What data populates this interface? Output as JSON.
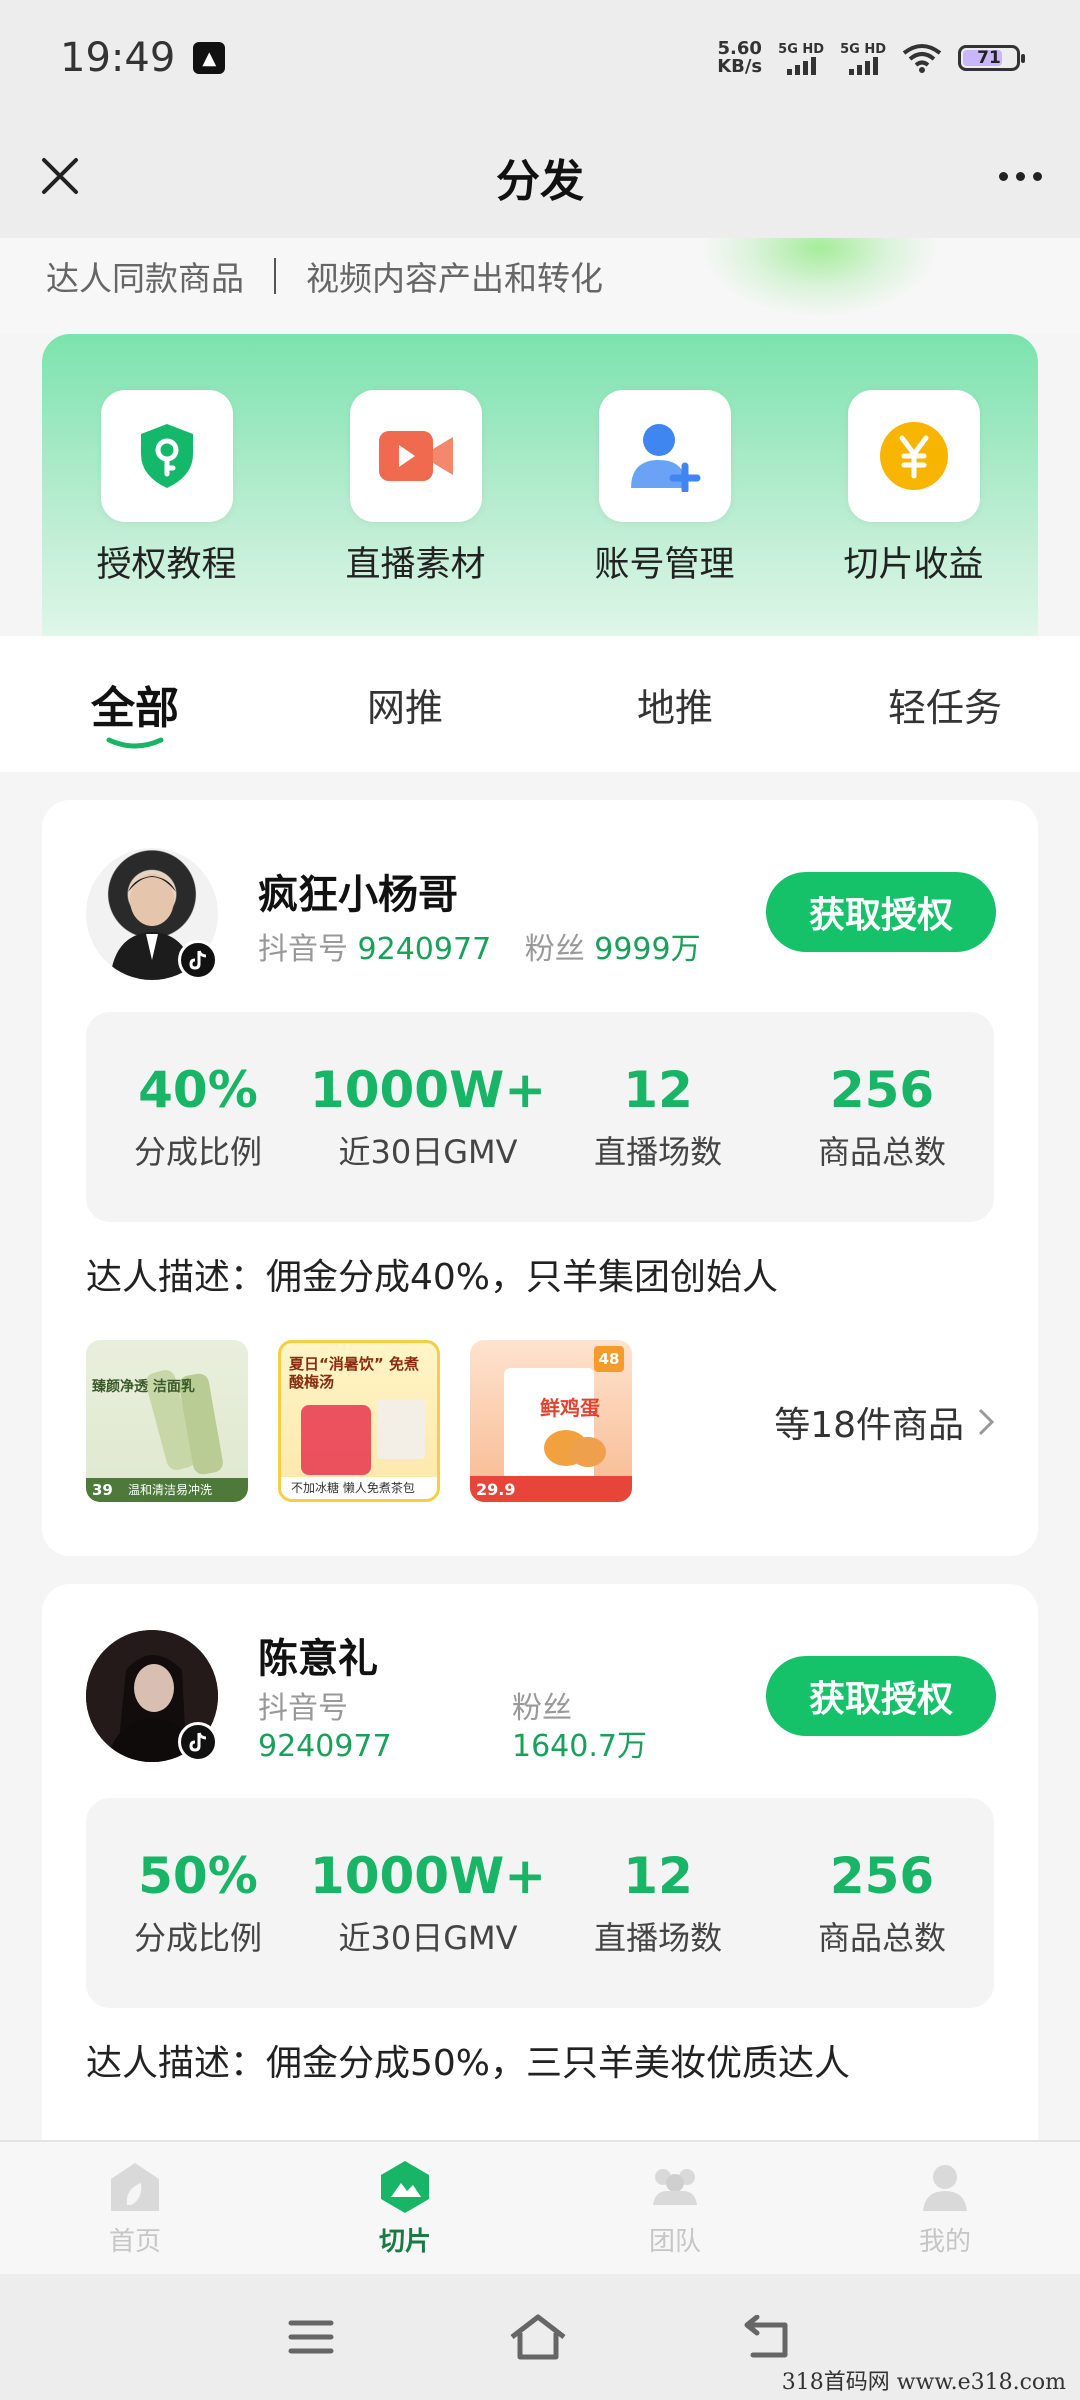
{
  "status_bar": {
    "time": "19:49",
    "net_speed_value": "5.60",
    "net_speed_unit": "KB/s",
    "sim1_label": "5G HD",
    "sim2_label": "5G HD",
    "battery_level": "71"
  },
  "header": {
    "title": "分发"
  },
  "banner": {
    "left_text": "达人同款商品",
    "right_text": "视频内容产出和转化"
  },
  "quick_access": [
    {
      "label": "授权教程",
      "icon": "shield-key-icon",
      "color": "#14b86a"
    },
    {
      "label": "直播素材",
      "icon": "video-camera-icon",
      "color": "#f06a4f"
    },
    {
      "label": "账号管理",
      "icon": "user-add-icon",
      "color": "#3f86f0"
    },
    {
      "label": "切片收益",
      "icon": "yen-coin-icon",
      "color": "#f7b500"
    }
  ],
  "tabs": [
    {
      "label": "全部",
      "active": true
    },
    {
      "label": "网推",
      "active": false
    },
    {
      "label": "地推",
      "active": false
    },
    {
      "label": "轻任务",
      "active": false
    }
  ],
  "creators": [
    {
      "name": "疯狂小杨哥",
      "douyin_label": "抖音号",
      "douyin_id": "9240977",
      "fans_label": "粉丝",
      "fans": "9999万",
      "auth_button": "获取授权",
      "stats": [
        {
          "value": "40%",
          "label": "分成比例"
        },
        {
          "value": "1000W+",
          "label": "近30日GMV"
        },
        {
          "value": "12",
          "label": "直播场数"
        },
        {
          "value": "256",
          "label": "商品总数"
        }
      ],
      "description": "达人描述：佣金分成40%，只羊集团创始人",
      "more_products": "等18件商品"
    },
    {
      "name": "陈意礼",
      "douyin_label": "抖音号",
      "douyin_id": "9240977",
      "fans_label": "粉丝",
      "fans": "1640.7万",
      "auth_button": "获取授权",
      "stats": [
        {
          "value": "50%",
          "label": "分成比例"
        },
        {
          "value": "1000W+",
          "label": "近30日GMV"
        },
        {
          "value": "12",
          "label": "直播场数"
        },
        {
          "value": "256",
          "label": "商品总数"
        }
      ],
      "description": "达人描述：佣金分成50%，三只羊美妆优质达人"
    }
  ],
  "products": [
    {
      "title": "臻颜净透 洁面乳",
      "price": "39",
      "caption": "温和清洁易冲洗"
    },
    {
      "title": "夏日“消暑饮” 免煮酸梅汤",
      "caption": "不加冰糖 懒人免煮茶包"
    },
    {
      "title": "鲜鸡蛋",
      "price": "29.9",
      "badge": "48"
    }
  ],
  "bottom_nav": [
    {
      "label": "首页",
      "icon": "home-leaf-icon",
      "active": false
    },
    {
      "label": "切片",
      "icon": "slice-mountain-icon",
      "active": true
    },
    {
      "label": "团队",
      "icon": "team-icon",
      "active": false
    },
    {
      "label": "我的",
      "icon": "profile-icon",
      "active": false
    }
  ],
  "watermark": "318首码网  www.e318.com"
}
